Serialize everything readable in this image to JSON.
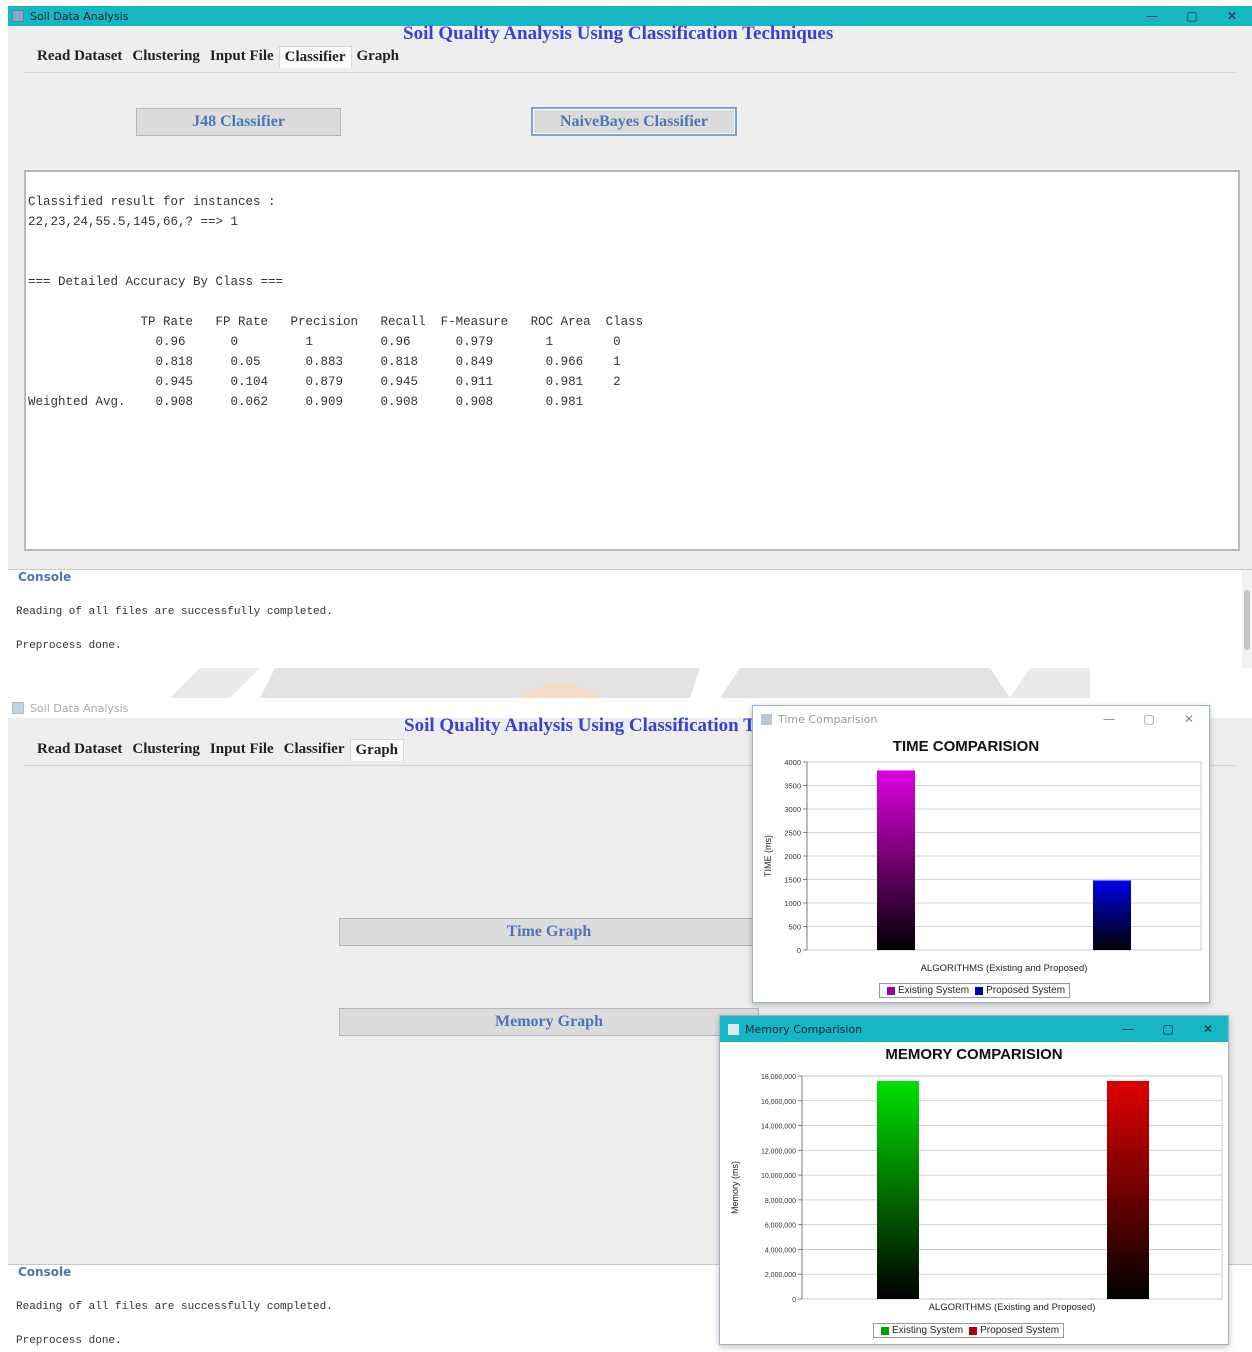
{
  "window1": {
    "title": "Soil Data Analysis",
    "controls": {
      "min": "—",
      "max": "▢",
      "close": "✕"
    },
    "app_title": "Soil Quality Analysis Using Classification Techniques",
    "menu": [
      "Read Dataset",
      "Clustering",
      "Input File",
      "Classifier",
      "Graph"
    ],
    "selected_menu": "Classifier",
    "buttons": {
      "j48": "J48 Classifier",
      "naive": "NaiveBayes Classifier"
    },
    "output_text": "Classified result for instances :\n22,23,24,55.5,145,66,? ==> 1\n\n\n=== Detailed Accuracy By Class ===\n\n               TP Rate   FP Rate   Precision   Recall  F-Measure   ROC Area  Class\n                 0.96      0         1         0.96      0.979       1        0\n                 0.818     0.05      0.883     0.818     0.849       0.966    1\n                 0.945     0.104     0.879     0.945     0.911       0.981    2\nWeighted Avg.    0.908     0.062     0.909     0.908     0.908       0.981",
    "console": {
      "label": "Console",
      "lines": [
        "Reading of all files are successfully completed.",
        "Preprocess done."
      ]
    }
  },
  "window2": {
    "title": "Soil Data Analysis",
    "app_title": "Soil Quality Analysis Using Classification Techniques",
    "menu": [
      "Read Dataset",
      "Clustering",
      "Input File",
      "Classifier",
      "Graph"
    ],
    "selected_menu": "Graph",
    "buttons": {
      "time": "Time Graph",
      "memory": "Memory Graph"
    },
    "console": {
      "label": "Console",
      "lines": [
        "Reading of all files are successfully completed.",
        "Preprocess done."
      ]
    }
  },
  "time_window": {
    "title": "Time Comparision",
    "controls": {
      "min": "—",
      "max": "▢",
      "close": "✕"
    }
  },
  "memory_window": {
    "title": "Memory Comparision",
    "controls": {
      "min": "—",
      "max": "▢",
      "close": "✕"
    }
  },
  "chart_data": [
    {
      "type": "bar",
      "title": "TIME COMPARISION",
      "xlabel": "ALGORITHMS (Existing and Proposed)",
      "ylabel": "TIME (ms)",
      "ylim": [
        0,
        4000
      ],
      "yticks": [
        0,
        500,
        1000,
        1500,
        2000,
        2500,
        3000,
        3500,
        4000
      ],
      "ytick_labels": [
        "0",
        "500",
        "1000",
        "1500",
        "2000",
        "2500",
        "3000",
        "3500",
        "4000"
      ],
      "series": [
        {
          "name": "Existing System",
          "values": [
            3820
          ],
          "color": "#e000e0"
        },
        {
          "name": "Proposed System",
          "values": [
            1480
          ],
          "color": "#0000e8"
        }
      ],
      "legend": "bottom",
      "grid": true
    },
    {
      "type": "bar",
      "title": "MEMORY COMPARISION",
      "xlabel": "ALGORITHMS (Existing and Proposed)",
      "ylabel": "Memory (ms)",
      "ylim": [
        0,
        18000000
      ],
      "yticks": [
        0,
        2000000,
        4000000,
        6000000,
        8000000,
        10000000,
        12000000,
        14000000,
        16000000,
        18000000
      ],
      "ytick_labels": [
        "0",
        "2,000,000",
        "4,000,000",
        "6,000,000",
        "8,000,000",
        "10,000,000",
        "12,000,000",
        "14,000,000",
        "16,000,000",
        "18,000,000"
      ],
      "series": [
        {
          "name": "Existing System",
          "values": [
            17600000
          ],
          "color": "#00e000"
        },
        {
          "name": "Proposed System",
          "values": [
            17600000
          ],
          "color": "#e00000"
        }
      ],
      "legend": "bottom",
      "grid": true
    }
  ]
}
